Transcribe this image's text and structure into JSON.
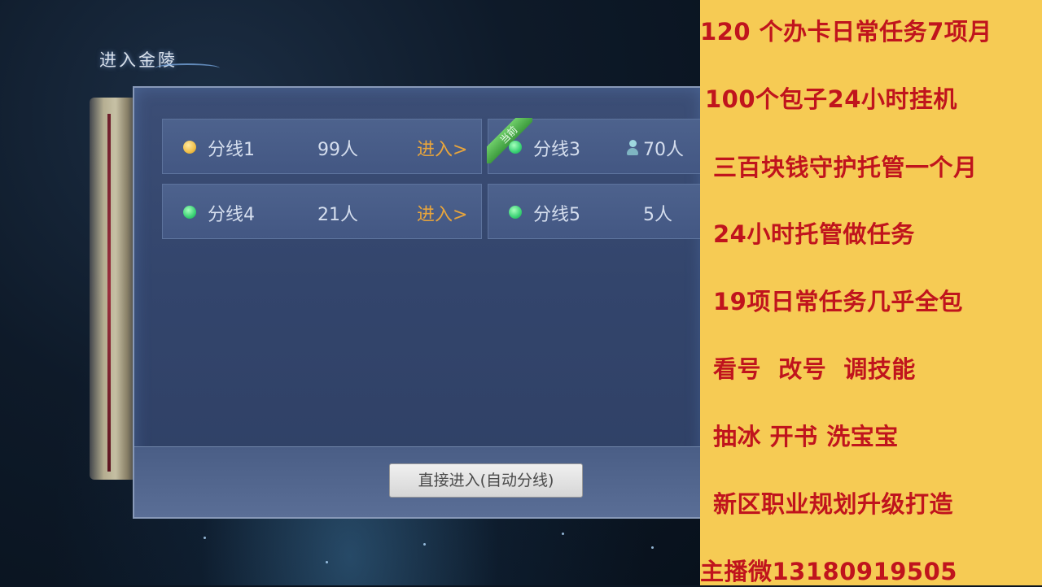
{
  "scene": {
    "title": "进入金陵"
  },
  "lines": [
    {
      "name": "分线1",
      "count": "99人",
      "enter": "进入>",
      "status": "yellow",
      "current": false
    },
    {
      "name": "分线3",
      "count": "70人",
      "enter": "",
      "status": "green",
      "current": true,
      "current_label": "当前"
    },
    {
      "name": "分线4",
      "count": "21人",
      "enter": "进入>",
      "status": "green",
      "current": false
    },
    {
      "name": "分线5",
      "count": "5人",
      "enter": "",
      "status": "green",
      "current": false
    }
  ],
  "auto_enter_button": "直接进入(自动分线)",
  "ad_lines": [
    "120 个办卡日常任务7项月",
    "100个包子24小时挂机",
    "三百块钱守护托管一个月",
    "24小时托管做任务",
    "19项日常任务几乎全包",
    "看号  改号  调技能",
    "抽冰 开书 洗宝宝",
    "新区职业规划升级打造",
    "主播微13180919505"
  ],
  "colors": {
    "ad_background": "#f6cb54",
    "ad_text": "#c0141d",
    "enter_text": "#e8a53c",
    "status_green": "#39d274",
    "status_yellow": "#f1bf48"
  }
}
